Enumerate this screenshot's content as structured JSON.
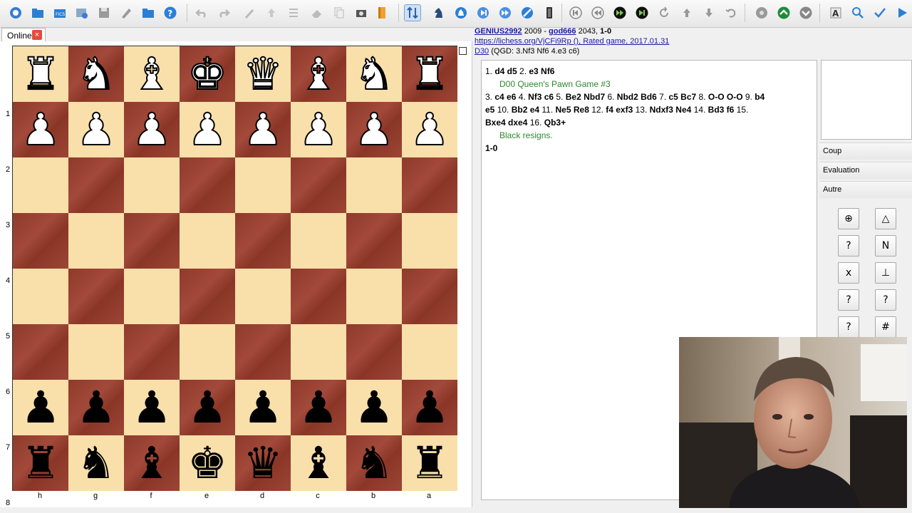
{
  "tab": {
    "label": "Online",
    "close": "×"
  },
  "board": {
    "rank_labels": [
      "1",
      "2",
      "3",
      "4",
      "5",
      "6",
      "7",
      "8"
    ],
    "file_labels": [
      "h",
      "g",
      "f",
      "e",
      "d",
      "c",
      "b",
      "a"
    ],
    "rows": [
      [
        "wR",
        "wN",
        "wB",
        "wK",
        "wQ",
        "wB",
        "wN",
        "wR"
      ],
      [
        "wP",
        "wP",
        "wP",
        "wP",
        "wP",
        "wP",
        "wP",
        "wP"
      ],
      [
        "",
        "",
        "",
        "",
        "",
        "",
        "",
        ""
      ],
      [
        "",
        "",
        "",
        "",
        "",
        "",
        "",
        ""
      ],
      [
        "",
        "",
        "",
        "",
        "",
        "",
        "",
        ""
      ],
      [
        "",
        "",
        "",
        "",
        "",
        "",
        "",
        ""
      ],
      [
        "bP",
        "bP",
        "bP",
        "bP",
        "bP",
        "bP",
        "bP",
        "bP"
      ],
      [
        "bR",
        "bN",
        "bB",
        "bK",
        "bQ",
        "bB",
        "bN",
        "bR"
      ]
    ]
  },
  "header": {
    "white_player": "GENIUS2992",
    "white_elo": "2009",
    "separator": "-",
    "black_player": "god666",
    "black_elo": "2043,",
    "result": "1-0",
    "event_link": "https://lichess.org/VjCFi9Rp (), Rated game, 2017.01.31",
    "eco_code": "D30",
    "eco_desc": "(QGD: 3.Nf3 Nf6 4.e3 c6)"
  },
  "notation": {
    "line1": [
      {
        "n": "1.",
        "m": "d4 d5"
      },
      {
        "n": "2.",
        "m": "e3 Nf6"
      }
    ],
    "comment1": "D00 Queen's Pawn Game #3",
    "line2": [
      {
        "n": "3.",
        "m": "c4 e6"
      },
      {
        "n": "4.",
        "m": "Nf3 c6"
      },
      {
        "n": "5.",
        "m": "Be2 Nbd7"
      },
      {
        "n": "6.",
        "m": "Nbd2 Bd6"
      },
      {
        "n": "7.",
        "m": "c5 Bc7"
      },
      {
        "n": "8.",
        "m": "O-O O-O"
      },
      {
        "n": "9.",
        "m": "b4"
      }
    ],
    "line3": [
      {
        "n": "",
        "m": "e5"
      },
      {
        "n": "10.",
        "m": "Bb2 e4"
      },
      {
        "n": "11.",
        "m": "Ne5 Re8"
      },
      {
        "n": "12.",
        "m": "f4 exf3"
      },
      {
        "n": "13.",
        "m": "Ndxf3 Ne4"
      },
      {
        "n": "14.",
        "m": "Bd3 f6"
      },
      {
        "n": "15.",
        "m": ""
      }
    ],
    "line4": [
      {
        "n": "",
        "m": "Bxe4 dxe4"
      },
      {
        "n": "16.",
        "m": "Qb3+"
      }
    ],
    "comment2": "Black resigns.",
    "result": "1-0"
  },
  "side_panel": {
    "sections": [
      "Coup",
      "Evaluation",
      "Autre"
    ],
    "symbols": [
      "⊕",
      "△",
      "?",
      "N",
      "x",
      "⊥",
      "?",
      "?",
      "?",
      "#"
    ]
  },
  "icons": {
    "toolbar_left": [
      "new-game-icon",
      "open-folder-icon",
      "fics-icon",
      "web-icon",
      "save-disk-icon",
      "pen-icon",
      "folder-icon",
      "help-icon"
    ],
    "toolbar_edit": [
      "undo-icon",
      "redo-icon",
      "edit-icon",
      "up-arrow-icon",
      "list-icon",
      "eraser-icon",
      "copy-icon",
      "camera-icon",
      "book-icon"
    ],
    "toolbar_play": [
      "flip-board-icon",
      "knight-icon",
      "knight-arrow-icon",
      "play-next-icon",
      "fast-forward-icon",
      "no-entry-icon",
      "clock-icon"
    ],
    "toolbar_nav": [
      "first-move-icon",
      "prev-move-icon",
      "next-move-icon",
      "last-move-icon",
      "refresh-icon",
      "up-icon",
      "down-icon",
      "undo-nav-icon"
    ],
    "toolbar_right": [
      "engine-icon",
      "up-circle-icon",
      "down-circle-icon",
      "text-size-icon",
      "zoom-icon",
      "check-arrow-icon",
      "play-icon"
    ]
  },
  "colors": {
    "light_square": "#f9dfaa",
    "dark_square": "#9c4535",
    "comment": "#2b8a2b",
    "link": "#1a1aa0"
  }
}
